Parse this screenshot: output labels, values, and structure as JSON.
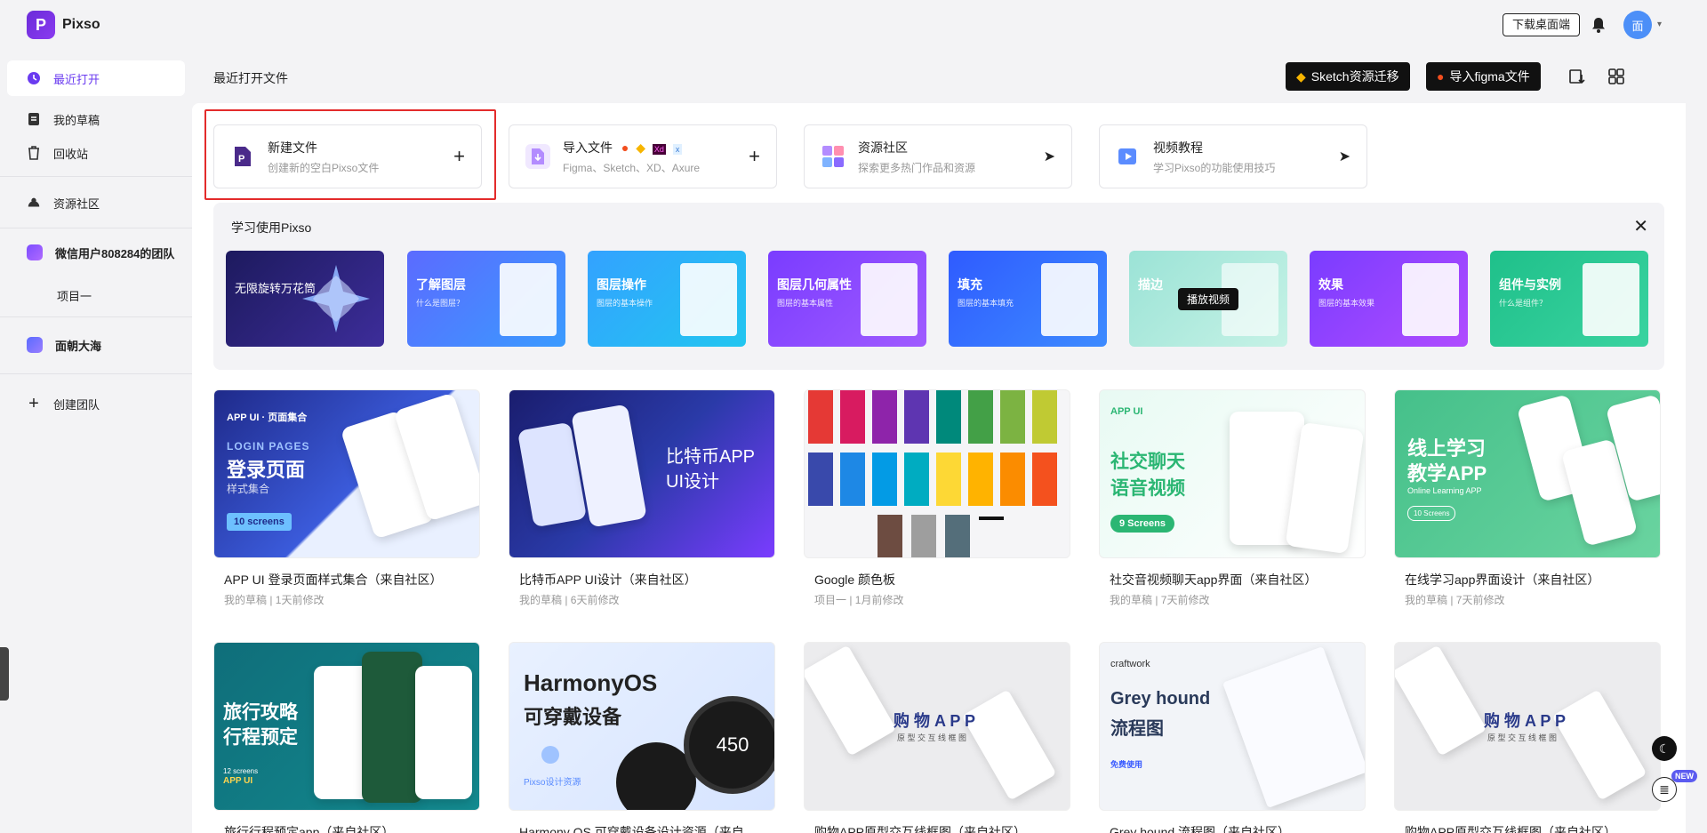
{
  "app": {
    "name": "Pixso"
  },
  "header": {
    "download_label": "下载桌面端",
    "avatar_text": "面"
  },
  "sidebar": {
    "items": [
      {
        "label": "最近打开",
        "icon": "clock-icon"
      },
      {
        "label": "我的草稿",
        "icon": "draft-icon"
      },
      {
        "label": "回收站",
        "icon": "trash-icon"
      },
      {
        "label": "资源社区",
        "icon": "community-icon"
      }
    ],
    "team": {
      "name": "微信用户808284的团队",
      "project": "项目一"
    },
    "team2": {
      "name": "面朝大海"
    },
    "create_team": "创建团队"
  },
  "content": {
    "title": "最近打开文件",
    "sketch_btn": "Sketch资源迁移",
    "figma_btn": "导入figma文件"
  },
  "quick": [
    {
      "title": "新建文件",
      "sub": "创建新的空白Pixso文件",
      "action": "+"
    },
    {
      "title": "导入文件",
      "sub": "Figma、Sketch、XD、Axure",
      "action": "+"
    },
    {
      "title": "资源社区",
      "sub": "探索更多热门作品和资源",
      "action": "➤"
    },
    {
      "title": "视频教程",
      "sub": "学习Pixso的功能使用技巧",
      "action": "➤"
    }
  ],
  "learn": {
    "title": "学习使用Pixso",
    "play_tip": "播放视频",
    "cards": [
      {
        "title": "无限旋转万花筒",
        "sub": ""
      },
      {
        "title": "了解图层",
        "sub": "什么是图层？"
      },
      {
        "title": "图层操作",
        "sub": "图层的基本操作"
      },
      {
        "title": "图层几何属性",
        "sub": "图层的基本属性"
      },
      {
        "title": "填充",
        "sub": "图层的基本填充"
      },
      {
        "title": "描边",
        "sub": ""
      },
      {
        "title": "效果",
        "sub": "图层的基本效果"
      },
      {
        "title": "组件与实例",
        "sub": "什么是组件？"
      }
    ]
  },
  "files": [
    {
      "title": "APP UI 登录页面样式集合（来自社区）",
      "meta": "我的草稿 | 1天前修改",
      "thumb": {
        "tag": "APP UI · 页面集合",
        "h1": "LOGIN PAGES",
        "h2": "登录页面",
        "h3": "样式集合",
        "badge": "10 screens"
      }
    },
    {
      "title": "比特币APP UI设计（来自社区）",
      "meta": "我的草稿 | 6天前修改",
      "thumb": {
        "h1": "比特币APP",
        "h2": "UI设计"
      }
    },
    {
      "title": "Google 颜色板",
      "meta": "项目一 | 1月前修改",
      "thumb": {}
    },
    {
      "title": "社交音视频聊天app界面（来自社区）",
      "meta": "我的草稿 | 7天前修改",
      "thumb": {
        "tag": "APP UI",
        "h1": "社交聊天",
        "h2": "语音视频",
        "badge": "9 Screens"
      }
    },
    {
      "title": "在线学习app界面设计（来自社区）",
      "meta": "我的草稿 | 7天前修改",
      "thumb": {
        "h1": "线上学习",
        "h2": "教学APP",
        "h3": "Online Learning APP",
        "badge": "10 Screens"
      }
    },
    {
      "title": "旅行行程预定app（来自社区）",
      "meta": "",
      "thumb": {
        "h1": "旅行攻略",
        "h2": "行程预定",
        "h3": "12 screens",
        "tag": "APP UI"
      }
    },
    {
      "title": "Harmony OS 可穿戴设备设计资源（来自",
      "meta": "",
      "thumb": {
        "h1": "HarmonyOS",
        "h2": "可穿戴设备",
        "h3": "Pixso设计资源",
        "watch": "450"
      }
    },
    {
      "title": "购物APP原型交互线框图（来自社区）",
      "meta": "",
      "thumb": {
        "h1": "购 物 A P P",
        "h2": "原 型 交 互 线 框 图"
      }
    },
    {
      "title": "Grey hound 流程图（来自社区）",
      "meta": "",
      "thumb": {
        "tag": "craftwork",
        "h1": "Grey hound",
        "h2": "流程图",
        "h3": "免费使用"
      }
    },
    {
      "title": "购物APP原型交互线框图（来自社区）",
      "meta": "",
      "thumb": {
        "h1": "购 物 A P P",
        "h2": "原 型 交 互 线 框 图"
      }
    }
  ],
  "floating": {
    "new_badge": "NEW"
  }
}
